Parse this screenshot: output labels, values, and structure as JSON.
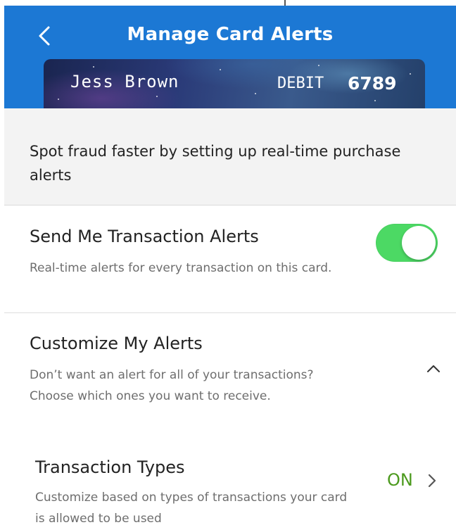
{
  "header": {
    "title": "Manage Card Alerts",
    "back_icon": "chevron-left-icon",
    "background_color": "#1c78d4"
  },
  "card": {
    "holder_name": "Jess Brown",
    "type": "DEBIT",
    "last4": "6789"
  },
  "intro": {
    "text": "Spot fraud faster by setting up real-time purchase alerts"
  },
  "transaction_alerts": {
    "title": "Send Me Transaction Alerts",
    "description": "Real-time alerts for every transaction on this card.",
    "toggle_on": true,
    "toggle_color": "#4cd964"
  },
  "customize": {
    "title": "Customize My Alerts",
    "description": "Don’t want an alert for all of your transactions? Choose which ones you want to receive.",
    "expanded": true,
    "icon": "chevron-up-icon"
  },
  "transaction_types": {
    "title": "Transaction Types",
    "description": "Customize based on types of transactions your card is allowed to be used",
    "status": "ON",
    "status_color": "#4c9a1e",
    "icon": "chevron-right-icon"
  }
}
